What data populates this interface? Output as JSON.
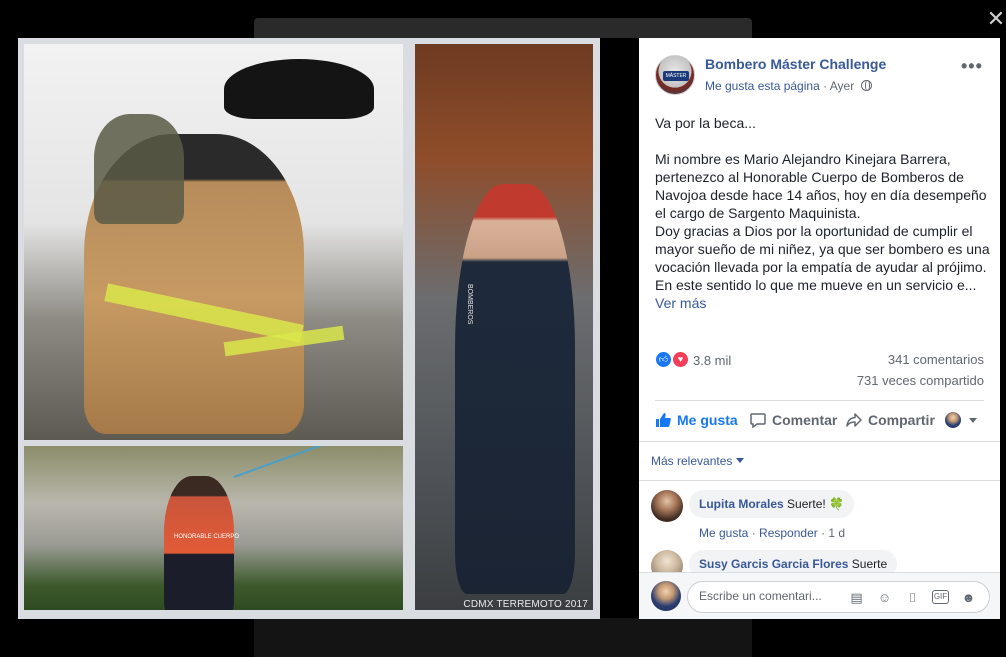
{
  "photo": {
    "watermark": "CDMX TERREMOTO 2017",
    "shirt_text": "HONORABLE CUERPO",
    "vest_text": "BOMBEROS"
  },
  "post": {
    "page_name": "Bombero Máster Challenge",
    "like_page": "Me gusta esta página",
    "separator": "·",
    "time": "Ayer",
    "privacy_icon": "globe-icon",
    "body": "Va por la beca...\n\nMi nombre es Mario Alejandro Kinejara Barrera, pertenezco al Honorable Cuerpo de Bomberos de Navojoa desde hace 14 años, hoy en día desempeño el cargo de Sargento Maquinista.\nDoy gracias a Dios por la oportunidad de cumplir el mayor sueño de mi niñez, ya que ser bombero es una vocación llevada por la empatía de ayudar al prójimo. En este sentido lo que me mueve en un servicio e... ",
    "see_more": "Ver más"
  },
  "stats": {
    "reactions": "3.8 mil",
    "comments": "341 comentarios",
    "shares": "731 veces compartido"
  },
  "actions": {
    "like": "Me gusta",
    "comment": "Comentar",
    "share": "Compartir"
  },
  "comments": {
    "sort_label": "Más relevantes",
    "items": [
      {
        "author": "Lupita Morales",
        "text": "Suerte!",
        "emoji": "🍀",
        "like": "Me gusta",
        "reply": "Responder",
        "time": "1 d"
      },
      {
        "author": "Susy Garcis Garcia Flores",
        "text": "Suerte"
      }
    ]
  },
  "composer": {
    "placeholder": "Escribe un comentari..."
  },
  "colors": {
    "link": "#385898",
    "like_blue": "#1877f2",
    "love_red": "#f33e58",
    "muted": "#616770"
  }
}
